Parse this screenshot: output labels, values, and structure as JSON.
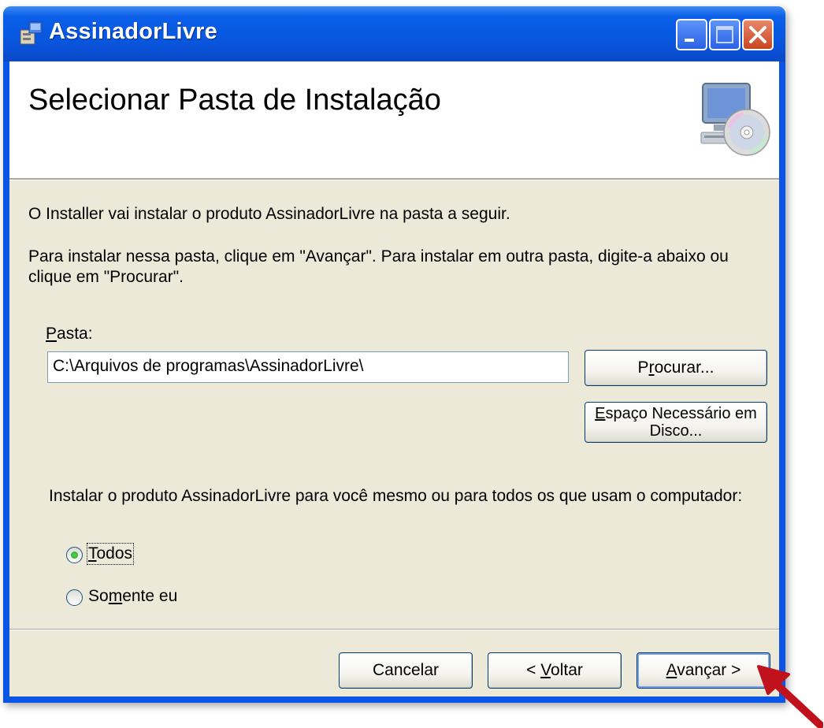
{
  "window": {
    "title": "AssinadorLivre",
    "icon": "installer-app-icon",
    "controls": [
      "minimize-icon",
      "maximize-icon",
      "close-icon"
    ]
  },
  "banner": {
    "title": "Selecionar Pasta de Instalação",
    "icon": "computer-cd-icon"
  },
  "body": {
    "intro": "O Installer vai instalar o produto AssinadorLivre na pasta a seguir.",
    "instructions_line1": "Para instalar nessa pasta, clique em \"Avançar\". Para instalar em outra pasta, digite-a abaixo ou",
    "instructions_line2": "clique em \"Procurar\"."
  },
  "folder": {
    "label_accel": "P",
    "label_rest": "asta:",
    "value": "C:\\Arquivos de programas\\AssinadorLivre\\",
    "browse_pre": "P",
    "browse_accel": "r",
    "browse_post": "ocurar...",
    "disk_space_accel": "E",
    "disk_space_rest": "spaço Necessário em Disco..."
  },
  "scope": {
    "question": "Instalar o produto AssinadorLivre para você mesmo ou para todos os que usam o computador:",
    "options": [
      {
        "accel": "T",
        "rest": "odos",
        "selected": true
      },
      {
        "pre": "So",
        "accel": "m",
        "rest": "ente eu",
        "selected": false
      }
    ]
  },
  "footer": {
    "cancel": "Cancelar",
    "back_pre": "< ",
    "back_accel": "V",
    "back_rest": "oltar",
    "next_accel": "A",
    "next_rest": "vançar >"
  },
  "colors": {
    "titlebar": "#0a54e6",
    "dialog_face": "#ece9d8",
    "annotation_arrow": "#c0121c"
  },
  "annotation": "red-arrow-pointer"
}
